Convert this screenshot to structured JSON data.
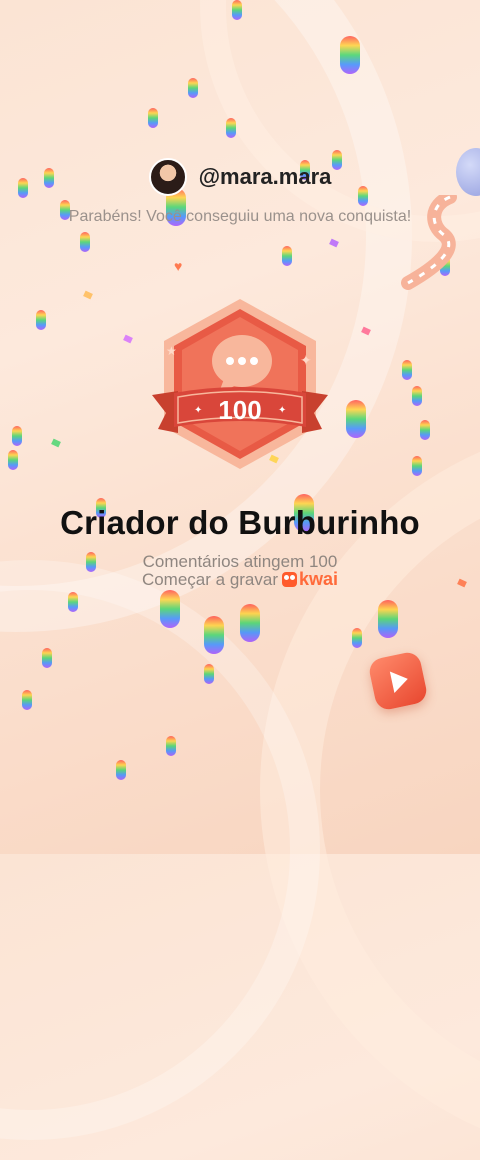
{
  "header": {
    "username": "@mara.mara",
    "congrats_text": "Parabéns! Você conseguiu uma nova conquista!"
  },
  "badge": {
    "count": "100",
    "icon": "chat-bubble-icon"
  },
  "achievement": {
    "title": "Criador do Burburinho",
    "description": "Comentários atingem 100",
    "cta": "Começar a gravar",
    "brand": "kwai"
  },
  "colors": {
    "badge_main": "#e85a45",
    "badge_light": "#f8b79c",
    "brand": "#ff5b2c"
  }
}
